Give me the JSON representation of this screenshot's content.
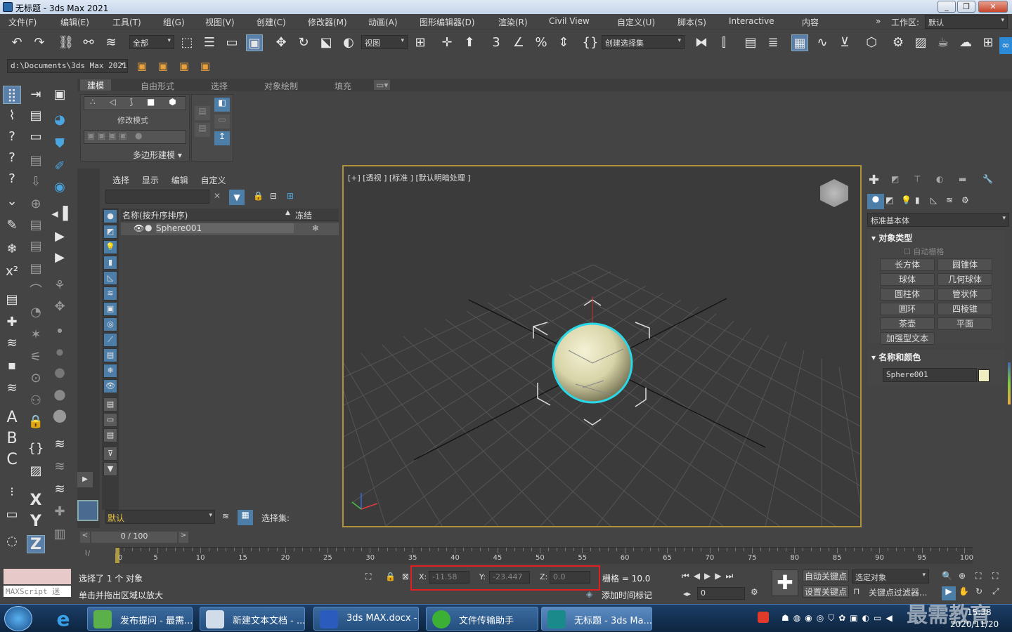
{
  "window": {
    "title": "无标题 - 3ds Max 2021"
  },
  "menubar": {
    "items": [
      "文件(F)",
      "编辑(E)",
      "工具(T)",
      "组(G)",
      "视图(V)",
      "创建(C)",
      "修改器(M)",
      "动画(A)",
      "图形编辑器(D)",
      "渲染(R)",
      "Civil View",
      "自定义(U)",
      "脚本(S)",
      "Interactive",
      "内容"
    ],
    "workspace_label": "工作区:",
    "workspace_value": "默认"
  },
  "toolbar": {
    "selection_filter": "全部",
    "ref_coord": "视图",
    "named_selection": "创建选择集",
    "project_path": "d:\\Documents\\3ds Max 2021"
  },
  "ribbon": {
    "tabs": [
      "建模",
      "自由形式",
      "选择",
      "对象绘制",
      "填充"
    ],
    "modify_mode_label": "修改模式",
    "poly_modeling_label": "多边形建模"
  },
  "scene_explorer": {
    "menu": [
      "选择",
      "显示",
      "编辑",
      "自定义"
    ],
    "col_name": "名称(按升序排序)",
    "col_freeze": "冻结",
    "objects": [
      {
        "name": "Sphere001"
      }
    ],
    "layer_value": "默认",
    "selection_set_label": "选择集:"
  },
  "viewport": {
    "label": "[+] [透视 ] [标准 ] [默认明暗处理 ]"
  },
  "command_panel": {
    "category": "标准基本体",
    "object_type_header": "对象类型",
    "auto_grid": "自动栅格",
    "buttons": [
      "长方体",
      "圆锥体",
      "球体",
      "几何球体",
      "圆柱体",
      "管状体",
      "圆环",
      "四棱锥",
      "茶壶",
      "平面",
      "加强型文本"
    ],
    "name_color_header": "名称和颜色",
    "object_name": "Sphere001",
    "object_color": "#f0eec0"
  },
  "timeline": {
    "frame_display": "0 / 100",
    "ticks": [
      "0",
      "5",
      "10",
      "15",
      "20",
      "25",
      "30",
      "35",
      "40",
      "45",
      "50",
      "55",
      "60",
      "65",
      "70",
      "75",
      "80",
      "85",
      "90",
      "95",
      "100"
    ]
  },
  "status": {
    "maxscript": "MAXScript 迷",
    "selected": "选择了 1 个 对象",
    "prompt": "单击并拖出区域以放大",
    "x_label": "X:",
    "x_value": "-11.58",
    "y_label": "Y:",
    "y_value": "-23.447",
    "z_label": "Z:",
    "z_value": "0.0",
    "grid": "栅格 = 10.0",
    "add_time_tag": "添加时间标记",
    "auto_key": "自动关键点",
    "set_key": "设置关键点",
    "selected_obj": "选定对象",
    "key_filters": "关键点过滤器...",
    "current_frame": "0"
  },
  "taskbar": {
    "items": [
      "发布提问 - 最需...",
      "新建文本文档 - ...",
      "3ds MAX.docx - ...",
      "文件传输助手",
      "无标题 - 3ds Ma..."
    ],
    "time": "15:38",
    "date": "2020/11/20",
    "watermark": "最需教育"
  }
}
